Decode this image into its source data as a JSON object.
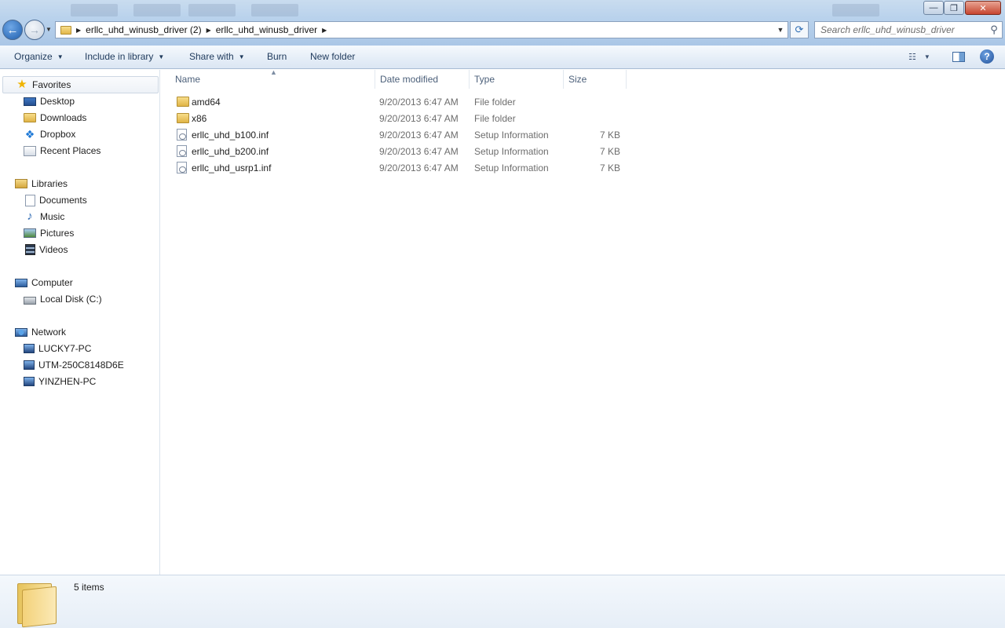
{
  "window": {
    "controls": {
      "minimize": "—",
      "maximize": "❐",
      "close": "✕"
    }
  },
  "address_bar": {
    "breadcrumbs": [
      "erllc_uhd_winusb_driver (2)",
      "erllc_uhd_winusb_driver"
    ],
    "search_placeholder": "Search erllc_uhd_winusb_driver"
  },
  "command_bar": {
    "organize": "Organize",
    "include_in_library": "Include in library",
    "share_with": "Share with",
    "burn": "Burn",
    "new_folder": "New folder"
  },
  "navigation": {
    "favorites": {
      "label": "Favorites",
      "items": [
        "Desktop",
        "Downloads",
        "Dropbox",
        "Recent Places"
      ]
    },
    "libraries": {
      "label": "Libraries",
      "items": [
        "Documents",
        "Music",
        "Pictures",
        "Videos"
      ]
    },
    "computer": {
      "label": "Computer",
      "items": [
        "Local Disk (C:)"
      ]
    },
    "network": {
      "label": "Network",
      "items": [
        "LUCKY7-PC",
        "UTM-250C8148D6E",
        "YINZHEN-PC"
      ]
    }
  },
  "file_list": {
    "columns": [
      "Name",
      "Date modified",
      "Type",
      "Size"
    ],
    "rows": [
      {
        "name": "amd64",
        "date": "9/20/2013 6:47 AM",
        "type": "File folder",
        "size": "",
        "icon": "folder-icon"
      },
      {
        "name": "x86",
        "date": "9/20/2013 6:47 AM",
        "type": "File folder",
        "size": "",
        "icon": "folder-icon"
      },
      {
        "name": "erllc_uhd_b100.inf",
        "date": "9/20/2013 6:47 AM",
        "type": "Setup Information",
        "size": "7 KB",
        "icon": "inf-file-icon"
      },
      {
        "name": "erllc_uhd_b200.inf",
        "date": "9/20/2013 6:47 AM",
        "type": "Setup Information",
        "size": "7 KB",
        "icon": "inf-file-icon"
      },
      {
        "name": "erllc_uhd_usrp1.inf",
        "date": "9/20/2013 6:47 AM",
        "type": "Setup Information",
        "size": "7 KB",
        "icon": "inf-file-icon"
      }
    ]
  },
  "details_pane": {
    "items_count": "5 items"
  },
  "colors": {
    "chrome_blue": "#b9d2ec",
    "text_link_blue": "#1e395b",
    "secondary_text": "#6d6d6d"
  }
}
